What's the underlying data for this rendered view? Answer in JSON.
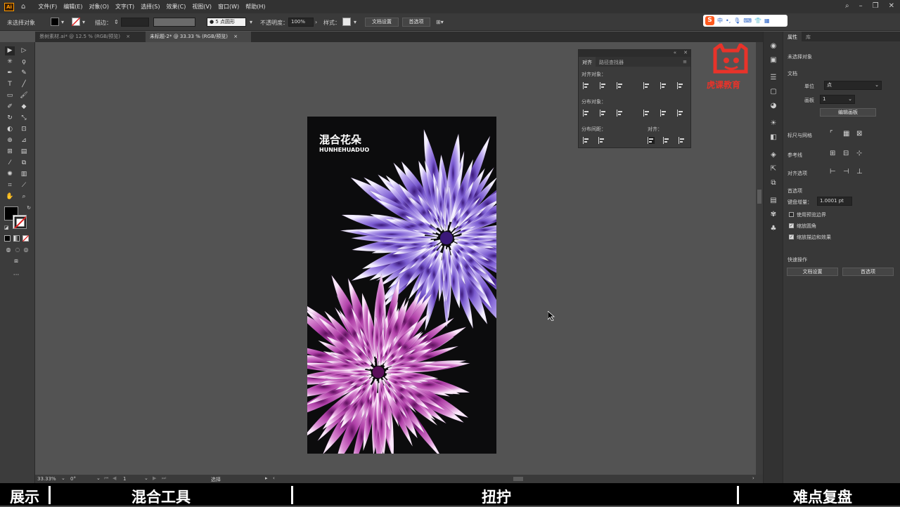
{
  "app": {
    "logo": "Ai",
    "menu": [
      "文件(F)",
      "编辑(E)",
      "对象(O)",
      "文字(T)",
      "选择(S)",
      "效果(C)",
      "视图(V)",
      "窗口(W)",
      "帮助(H)"
    ]
  },
  "control": {
    "selection": "未选择对象",
    "stroke_label": "描边：",
    "brush": "5 点圆形",
    "opacity_label": "不透明度：",
    "opacity": "100%",
    "style_label": "样式：",
    "doc_setup": "文档设置",
    "prefs": "首选项"
  },
  "ime": {
    "logo": "S",
    "mode": "中",
    "punct": "•,"
  },
  "tabs": [
    {
      "label": "景树素材.ai* @ 12.5 % (RGB/预览)",
      "close": "×"
    },
    {
      "label": "未标题-2* @ 33.33 % (RGB/预览)",
      "close": "×"
    }
  ],
  "artboard": {
    "title": "混合花朵",
    "subtitle": "HUNHEHUADUO"
  },
  "align_panel": {
    "tabs": [
      "对齐",
      "路径查找器"
    ],
    "align_objects": "对齐对象：",
    "distribute_objects": "分布对象：",
    "distribute_spacing": "分布间距：",
    "align_to": "对齐："
  },
  "props": {
    "tabs": [
      "属性",
      "库"
    ],
    "no_selection": "未选择对象",
    "document": "文档",
    "units_label": "单位",
    "units_value": "点",
    "artboard_label": "画板",
    "artboard_value": "1",
    "edit_artboards": "编辑画板",
    "rulers_grids": "标尺与网格",
    "guides": "参考线",
    "align_options": "对齐选项",
    "preferences": "首选项",
    "keyboard_increment_label": "键盘增量：",
    "keyboard_increment": "1.0001 pt",
    "cb_preview_bounds": "使用预览边界",
    "cb_scale_corners": "缩放圆角",
    "cb_scale_strokes": "缩放描边和效果",
    "quick_actions": "快速操作",
    "btn_doc_setup": "文档设置",
    "btn_prefs": "首选项"
  },
  "status": {
    "zoom": "33.33%",
    "angle": "0°",
    "artboard": "1",
    "tool": "选择"
  },
  "captions": [
    "展示",
    "混合工具",
    "扭拧",
    "难点复盘"
  ],
  "watermark": {
    "text": "虎课教育"
  },
  "colors": {
    "accent_purple": "#7a5bd0",
    "accent_magenta": "#b040a8",
    "watermark_red": "#e8332a"
  }
}
